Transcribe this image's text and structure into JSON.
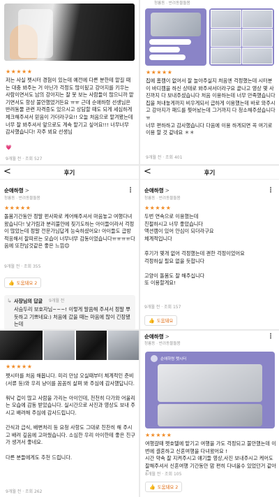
{
  "common": {
    "stars": "★★★★★",
    "header_title": "후기",
    "back_glyph": "<",
    "chevron": ">",
    "more_glyph": "⋮"
  },
  "t1": {
    "body": "저는 사실 펫시터 경험이 있는데 예전에 다른 분한테 맡길 때는 대충 봐주는 거 아닌가 걱정도 많이됬고 강아지를 키우는 사람이면서도 남의 강아지는 잘 못 보는 사람들이 많으니까 맡기면서도 항상 불안했었거든요 ㅠㅠ 근데 순애하령 선생님은 반려동물 관련 자격증도 있으시고 상담할 때도 되게 세심하게 체크해주셔서 믿음이 가더라구요!! 오늘 처음으로 맡겨봤는데 너무 잘 봐주셔서 앞으로도 계속 맡기고 싶어요!!! 너무너무 감사했습니다! 자주 뵈요 선생님",
    "heart": "💗",
    "meta": "9개월 전 · 조회 527"
  },
  "t2": {
    "sub": "청룡동 · 반려동물돌봄",
    "body": "집에 홈캠이 없어서 잘 놀아주실지 처음엔 걱정했는데 시터분이 바디캠을 하신 상태로 봐주셔서더라구요 끝나고 영상 몇 사진까지 다 보내주셨습니다 처음 이용하는데 너무 만족했습니다 집을 처내놓게까지 비우게되서 급하게 이용했는데 바로 와주시고 강아지가 패드를 찢어놨는데 그거까지 다 청소해주셨습니다 ㅠ\n너무 편하하고 감사했습니다 다음에 이용 하게되면 꼭 여기로 이용 할 것 같네요 ＊＊",
    "meta": "9개월 전 · 조회 401"
  },
  "t3": {
    "user": "순애하령",
    "sub": "청룡동 · 반려동물돌봄",
    "body": "돌봄기간동안 정말 펀사파로 케어해주셔서 마음놓고 여행다녀왔습니다! 낯가림과 분리불안에 짖기도하는 아이들이라서 걱정이 많았는데 정말 전문가님답게 능숙하셨어요! 아이들도 급방 적응해서 잘따르는 모습이 너무너무 감동이었습니다ㅠㅠㅠㅠ다음에 또한남것같은 좋은 느낌😊",
    "meta": "9개월 전 · 조회 355",
    "helpful": "도움돼요 2",
    "reply_title": "사장님의 답글",
    "reply_meta": "9개월 전",
    "reply_body": "사슴두리 보호자님~~~! 이렇게 말씀해 주셔서 정말 뿌듯하고 기쁘네요:) 처음에 갔을 때는 마음에 많이 긴장됐는데"
  },
  "t4": {
    "user": "순애하령",
    "sub": "청룡동 · 반려동물돌봄",
    "body": "두번 연속으로 이용했는데\n친절하시고 너무 좋았습니다\n액션캠이 있어 안심이 되더라구요\n체계적입니다\n\n후기가 몇개 없어 걱정했는데 괜한 걱정이었어요\n걱정하실 필요 없을 듯합니다\n\n고양이 돌봄도 잘 해주십니다\n또 이용할게요!",
    "meta": "9개월 전 · 조회 157",
    "helpful": "도움돼요"
  },
  "t5": {
    "body": "펫시터를 처음 해봅니다. 미리 만남 오실때부터 체계적인 준비(서류 등)와 우리 냥이를 꼼꼼히 살펴 봐 주심에 감사했답니다.\n\n워낙 겁이 많고 사람을 가리는 아이인데, 천천히 다가와 어울리는 모습에 감동 받았습니다. 실시간으로 사진과 영상도 보내 주시고 배려해 주심에 감사드립니다.\n\n간식과 급식, 배변처리 등 요청 사항도 그대로 친찬히 해 주시고 배려 깊음에 고마웠습니다. 소심한 우리 아이한테 좋은 친구가 생겨서 좋네요.\n\n다른 분들에게도 추천 드립니다.",
    "meta": "9개월 전 · 조회 262"
  },
  "t6": {
    "user": "순애하령",
    "sub": "청룡동 · 반려동물돌봄",
    "chat_name": "순애하령 펫시터",
    "body": "여행갈때 펫호텔에 맡기고 여행을 가도 걱정되고 불안했는데 이번에 결혼하고 신혼여행을 다녀왔어요 !\n시간 약속 잘 지켜주시고 얘기들 영상,사진 보내주시고 케어도 잘해주셔서 신혼여행 기간동안 맘 편히 다녀올수 있었던거 같아요 !!",
    "meta": "8개월 전 · 조회 105",
    "helpful": "도움돼요 2"
  }
}
